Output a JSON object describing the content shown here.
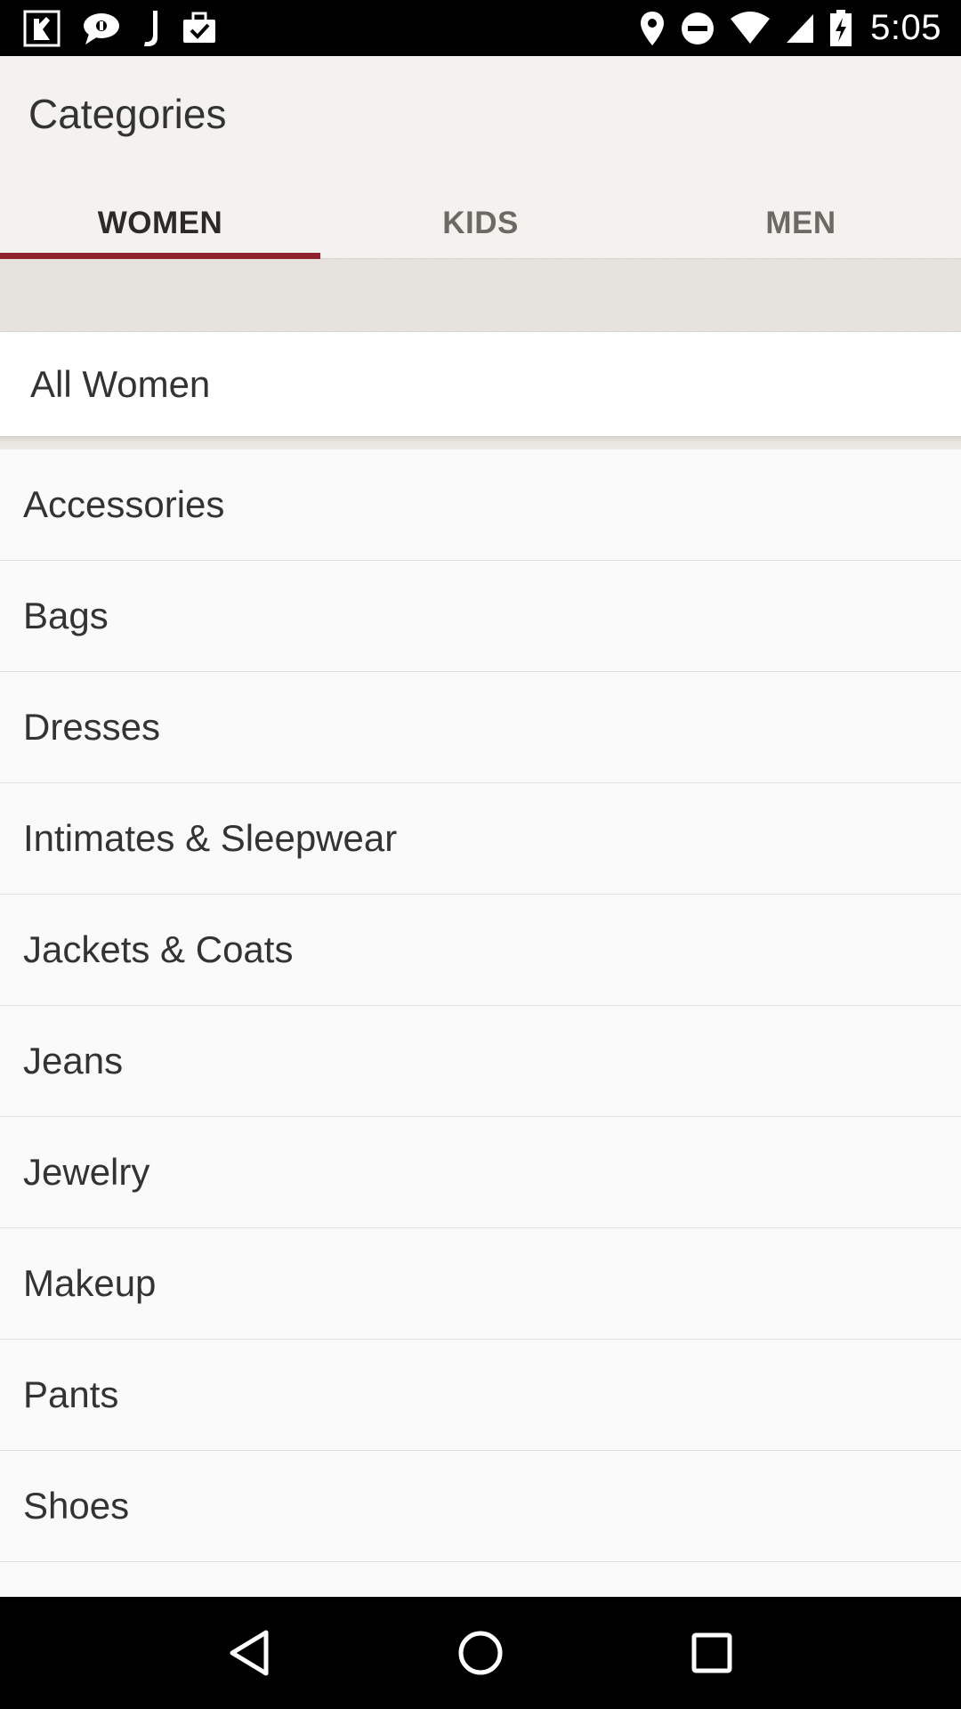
{
  "status_bar": {
    "time": "5:05",
    "left_icons": [
      "app-notification-icon",
      "chat-bubble-icon",
      "j-app-icon",
      "briefcase-check-icon"
    ],
    "right_icons": [
      "location-pin-icon",
      "do-not-disturb-icon",
      "wifi-icon",
      "cell-signal-icon",
      "battery-charging-icon"
    ]
  },
  "app_bar": {
    "title": "Categories",
    "tabs": [
      {
        "label": "WOMEN",
        "active": true
      },
      {
        "label": "KIDS",
        "active": false
      },
      {
        "label": "MEN",
        "active": false
      }
    ]
  },
  "content": {
    "all_label": "All Women",
    "categories": [
      "Accessories",
      "Bags",
      "Dresses",
      "Intimates & Sleepwear",
      "Jackets & Coats",
      "Jeans",
      "Jewelry",
      "Makeup",
      "Pants",
      "Shoes"
    ]
  },
  "colors": {
    "accent": "#8d222c",
    "app_bar_bg": "#f4f2ee",
    "list_bg": "#fafafa"
  },
  "nav_bar": {
    "buttons": [
      "back-triangle-icon",
      "home-circle-icon",
      "recents-square-icon"
    ]
  }
}
